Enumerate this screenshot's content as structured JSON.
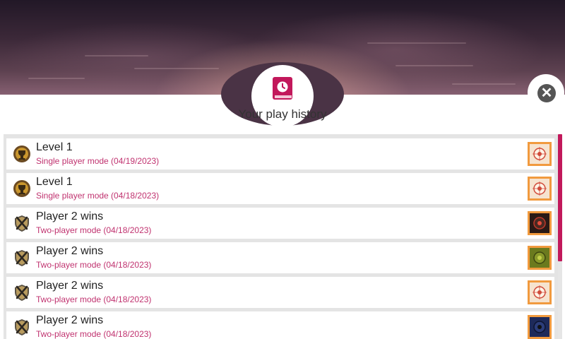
{
  "header": {
    "title": "Your play history",
    "history_icon": "book-clock-icon",
    "close_icon": "close-icon"
  },
  "colors": {
    "accent": "#c2185b",
    "subtitle": "#c0326f",
    "thumb_frame": "#f19a3e"
  },
  "history": [
    {
      "title": "Level 1",
      "subtitle": "Single player mode (04/19/2023)",
      "badge": "trophy-medal-icon",
      "thumb": "cream-board-thumbnail"
    },
    {
      "title": "Level 1",
      "subtitle": "Single player mode (04/18/2023)",
      "badge": "trophy-medal-icon",
      "thumb": "cream-board-thumbnail"
    },
    {
      "title": "Player 2 wins",
      "subtitle": "Two-player mode (04/18/2023)",
      "badge": "crossed-swords-shield-icon",
      "thumb": "dark-red-board-thumbnail"
    },
    {
      "title": "Player 2 wins",
      "subtitle": "Two-player mode (04/18/2023)",
      "badge": "crossed-swords-shield-icon",
      "thumb": "green-board-thumbnail"
    },
    {
      "title": "Player 2 wins",
      "subtitle": "Two-player mode (04/18/2023)",
      "badge": "crossed-swords-shield-icon",
      "thumb": "cream-board-thumbnail"
    },
    {
      "title": "Player 2 wins",
      "subtitle": "Two-player mode (04/18/2023)",
      "badge": "crossed-swords-shield-icon",
      "thumb": "blue-board-thumbnail"
    }
  ]
}
